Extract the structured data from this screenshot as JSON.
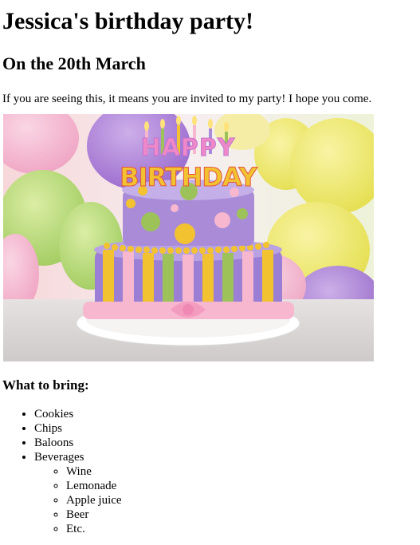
{
  "page": {
    "title": "Jessica's birthday party!",
    "subtitle": "On the 20th March",
    "intro": "If you are seeing this, it means you are invited to my party! I hope you come."
  },
  "image": {
    "topper_line1": "HAPPY",
    "topper_line2": "BIRTHDAY"
  },
  "bring": {
    "heading": "What to bring:",
    "items": [
      "Cookies",
      "Chips",
      "Baloons",
      "Beverages"
    ],
    "beverages": [
      "Wine",
      "Lemonade",
      "Apple juice",
      "Beer",
      "Etc."
    ]
  },
  "colors": {
    "cake_top": "#a98bd8",
    "cake_bottom": "#9b7fd4",
    "frosting_pink": "#f6b7cf",
    "dots_yellow": "#f2c230",
    "dots_green": "#9ec25a",
    "plate": "#f4f1f1"
  }
}
